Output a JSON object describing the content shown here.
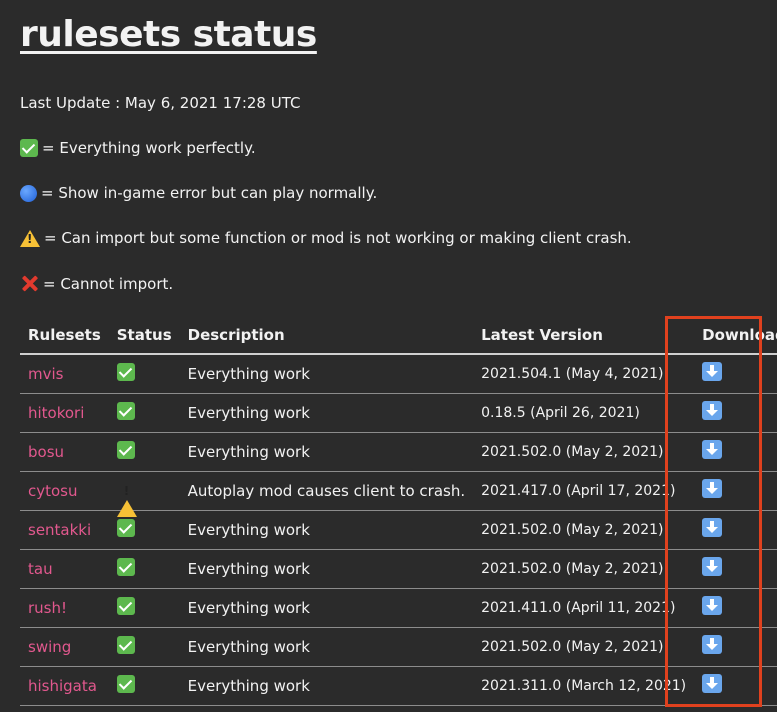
{
  "title": "rulesets status",
  "last_update": "Last Update : May 6, 2021 17:28 UTC",
  "legend": [
    {
      "icon": "check-icon",
      "text": "= Everything work perfectly."
    },
    {
      "icon": "blue-circle-icon",
      "text": "= Show in-game error but can play normally."
    },
    {
      "icon": "warning-icon",
      "text": "= Can import but some function or mod is not working or making client crash."
    },
    {
      "icon": "cross-icon",
      "text": "= Cannot import."
    }
  ],
  "table": {
    "headers": [
      "Rulesets",
      "Status",
      "Description",
      "Latest Version",
      "Download"
    ],
    "rows": [
      {
        "name": "mvis",
        "status": "check-icon",
        "description": "Everything work",
        "version": "2021.504.1 (May 4, 2021)"
      },
      {
        "name": "hitokori",
        "status": "check-icon",
        "description": "Everything work",
        "version": "0.18.5 (April 26, 2021)"
      },
      {
        "name": "bosu",
        "status": "check-icon",
        "description": "Everything work",
        "version": "2021.502.0 (May 2, 2021)"
      },
      {
        "name": "cytosu",
        "status": "warning-icon",
        "description": "Autoplay mod causes client to crash.",
        "version": "2021.417.0 (April 17, 2021)"
      },
      {
        "name": "sentakki",
        "status": "check-icon",
        "description": "Everything work",
        "version": "2021.502.0 (May 2, 2021)"
      },
      {
        "name": "tau",
        "status": "check-icon",
        "description": "Everything work",
        "version": "2021.502.0 (May 2, 2021)"
      },
      {
        "name": "rush!",
        "status": "check-icon",
        "description": "Everything work",
        "version": "2021.411.0 (April 11, 2021)"
      },
      {
        "name": "swing",
        "status": "check-icon",
        "description": "Everything work",
        "version": "2021.502.0 (May 2, 2021)"
      },
      {
        "name": "hishigata",
        "status": "check-icon",
        "description": "Everything work",
        "version": "2021.311.0 (March 12, 2021)"
      }
    ]
  },
  "colors": {
    "background": "#2b2b2b",
    "link": "#e2588e",
    "highlight": "#e0411e"
  }
}
